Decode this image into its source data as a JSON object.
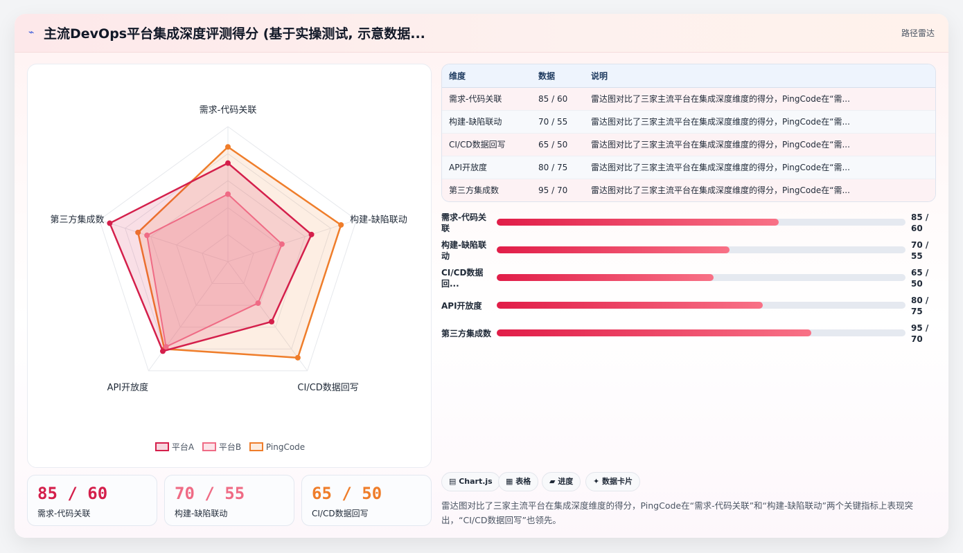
{
  "header": {
    "icon": "line-chart-icon",
    "title": "主流DevOps平台集成深度评测得分 (基于实操测试, 示意数据...",
    "badge": "路径雷达"
  },
  "colors": {
    "platform_a": "#d41f4b",
    "platform_b": "#ef6b85",
    "pingcode": "#ef7d2a"
  },
  "chart_data": {
    "type": "radar",
    "axes": [
      "需求-代码关联",
      "构建-缺陷联动",
      "CI/CD数据回写",
      "API开放度",
      "第三方集成数"
    ],
    "range": [
      0,
      100
    ],
    "series": [
      {
        "name": "平台A",
        "values": [
          73,
          65,
          55,
          82,
          92
        ]
      },
      {
        "name": "平台B",
        "values": [
          50,
          42,
          38,
          78,
          63
        ]
      },
      {
        "name": "PingCode",
        "values": [
          85,
          88,
          88,
          80,
          70
        ]
      }
    ],
    "legend_position": "bottom"
  },
  "table": {
    "headers": [
      "维度",
      "数据",
      "说明"
    ],
    "rows": [
      [
        "需求-代码关联",
        "85 / 60",
        "雷达图对比了三家主流平台在集成深度维度的得分，PingCode在“需..."
      ],
      [
        "构建-缺陷联动",
        "70 / 55",
        "雷达图对比了三家主流平台在集成深度维度的得分，PingCode在“需..."
      ],
      [
        "CI/CD数据回写",
        "65 / 50",
        "雷达图对比了三家主流平台在集成深度维度的得分，PingCode在“需..."
      ],
      [
        "API开放度",
        "80 / 75",
        "雷达图对比了三家主流平台在集成深度维度的得分，PingCode在“需..."
      ],
      [
        "第三方集成数",
        "95 / 70",
        "雷达图对比了三家主流平台在集成深度维度的得分，PingCode在“需..."
      ]
    ]
  },
  "progress": [
    {
      "label": "需求-代码关联",
      "value": "85 / 60",
      "fill": 0.69
    },
    {
      "label": "构建-缺陷联动",
      "value": "70 / 55",
      "fill": 0.57
    },
    {
      "label": "CI/CD数据回...",
      "value": "65 / 50",
      "fill": 0.53
    },
    {
      "label": "API开放度",
      "value": "80 / 75",
      "fill": 0.65
    },
    {
      "label": "第三方集成数",
      "value": "95 / 70",
      "fill": 0.77
    }
  ],
  "stats": [
    {
      "value": "85 / 60",
      "label": "需求-代码关联"
    },
    {
      "value": "70 / 55",
      "label": "构建-缺陷联动"
    },
    {
      "value": "65 / 50",
      "label": "CI/CD数据回写"
    }
  ],
  "chips": [
    {
      "icon": "chart-icon",
      "label": "▤ Chart.js"
    },
    {
      "icon": "table-icon",
      "label": "▦ 表格"
    },
    {
      "icon": "progress-icon",
      "label": "▰ 进度"
    },
    {
      "icon": "card-icon",
      "label": "✦ 数据卡片"
    }
  ],
  "description": "雷达图对比了三家主流平台在集成深度维度的得分，PingCode在“需求-代码关联”和“构建-缺陷联动”两个关键指标上表现突出，“CI/CD数据回写”也领先。"
}
